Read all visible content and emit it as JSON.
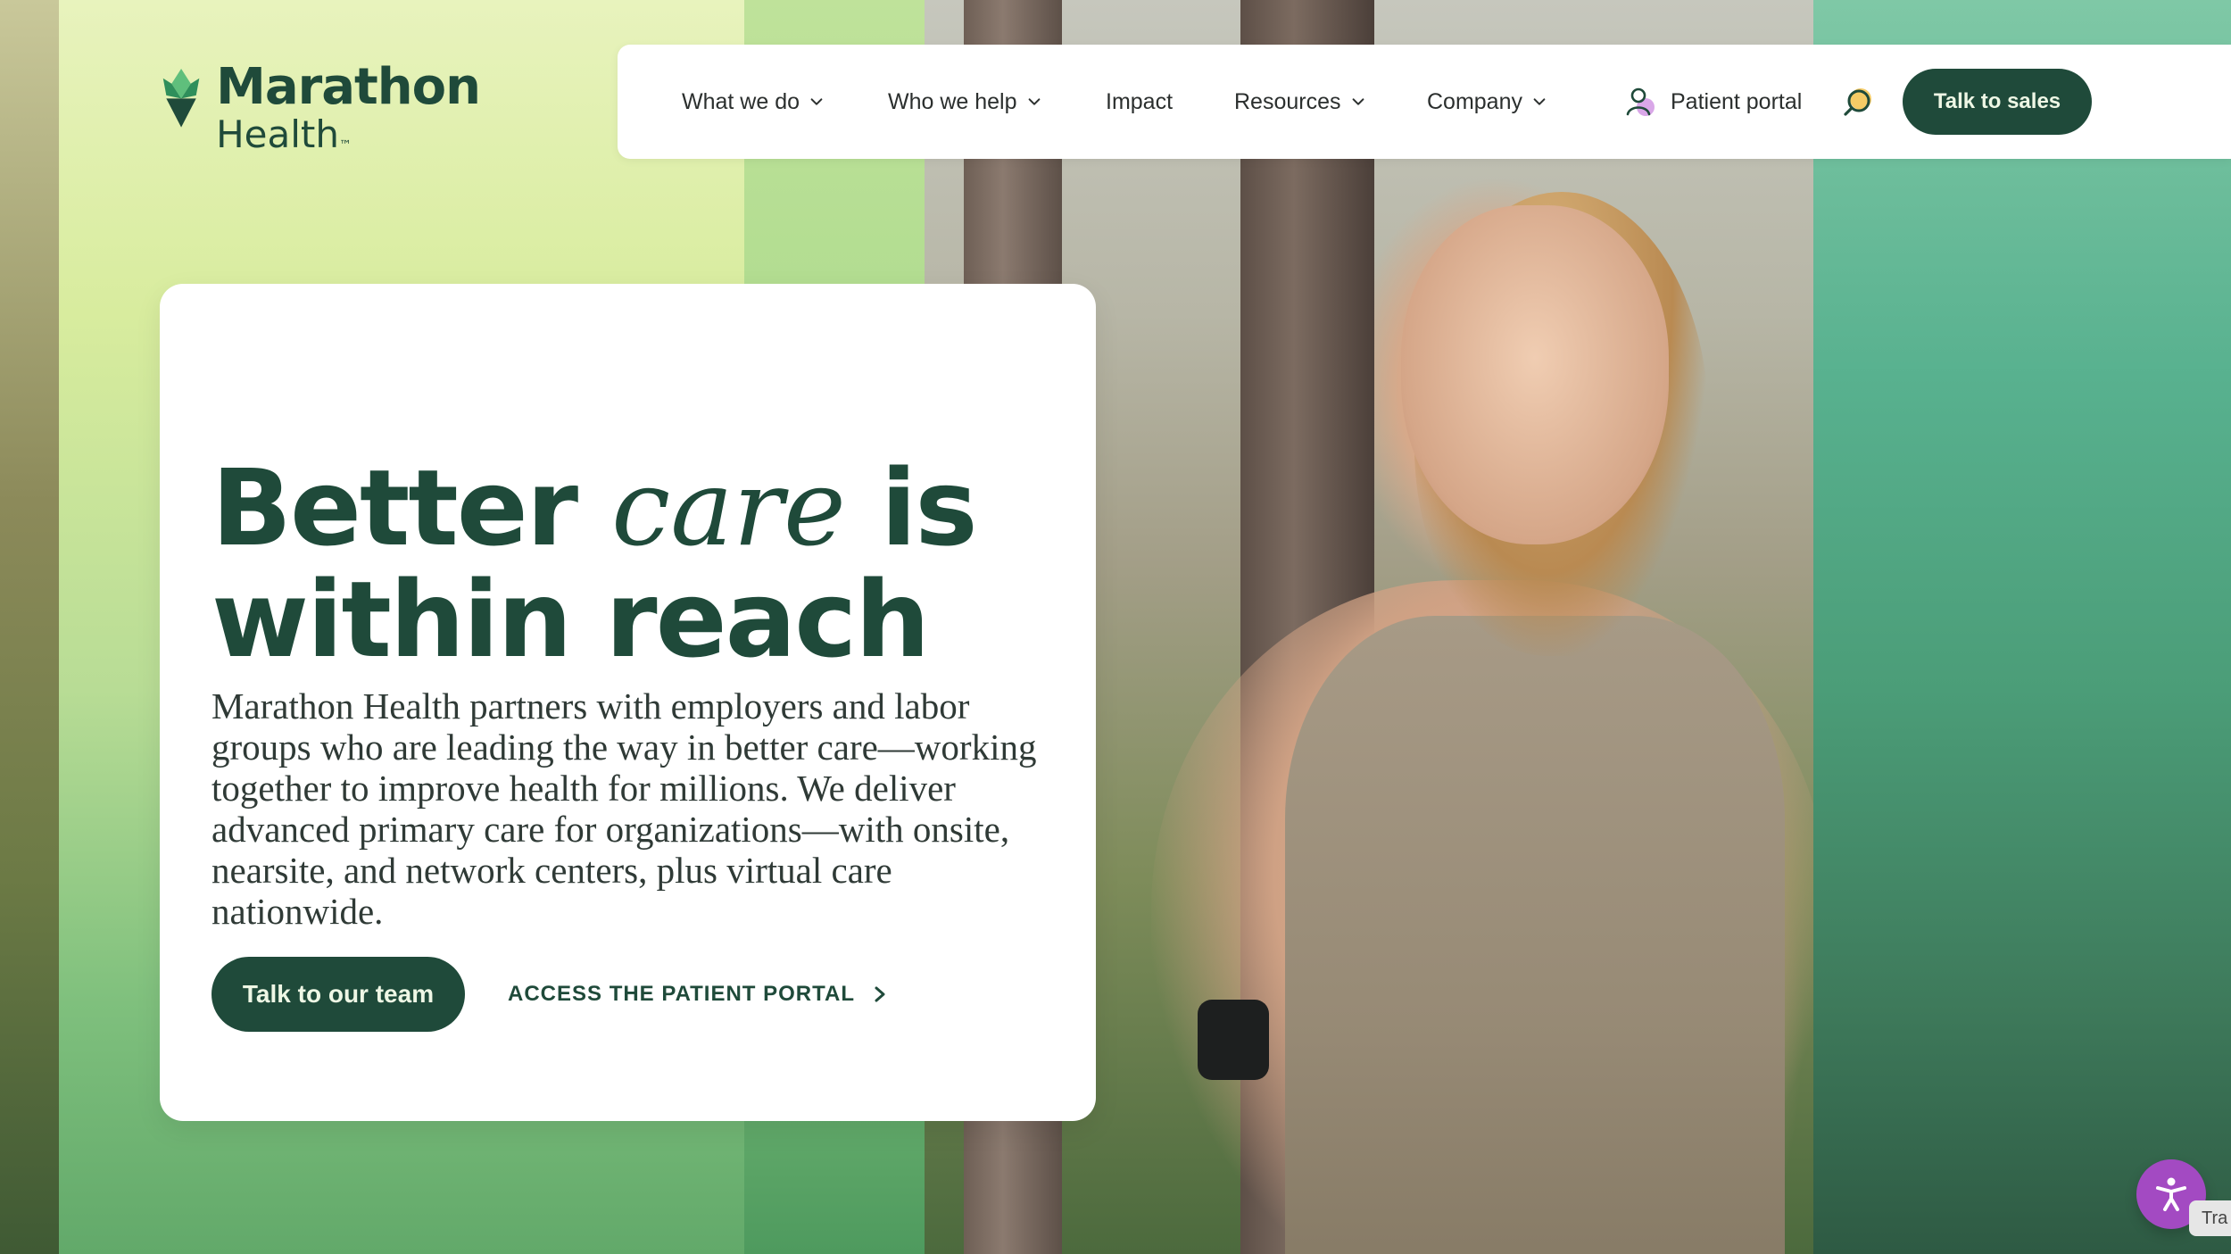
{
  "brand": {
    "name_line1": "Marathon",
    "name_line2": "Health",
    "trademark": "™",
    "colors": {
      "primary_dark_green": "#1f4a3a",
      "button_text": "#eef7e5",
      "accent_purple": "#a34ac2"
    }
  },
  "nav": {
    "items": [
      {
        "label": "What we do",
        "has_dropdown": true
      },
      {
        "label": "Who we help",
        "has_dropdown": true
      },
      {
        "label": "Impact",
        "has_dropdown": false
      },
      {
        "label": "Resources",
        "has_dropdown": true
      },
      {
        "label": "Company",
        "has_dropdown": true
      }
    ],
    "patient_portal": {
      "label": "Patient portal",
      "icon": "user-icon"
    },
    "search": {
      "icon": "search-icon"
    },
    "talk_to_sales": {
      "label": "Talk to sales"
    }
  },
  "hero": {
    "headline": {
      "part1": "Better",
      "part2": "care",
      "part3": "is",
      "line2": "within reach"
    },
    "body": "Marathon Health partners with employers and labor groups who are leading the way in better care—working together to improve health for millions. We deliver advanced primary care for organizations—with onsite, nearsite, and network centers, plus virtual care nationwide.",
    "primary_cta": {
      "label": "Talk to our team"
    },
    "secondary_cta": {
      "label": "ACCESS THE PATIENT PORTAL",
      "icon": "chevron-right-icon"
    }
  },
  "utility": {
    "accessibility_button": {
      "icon": "accessibility-icon"
    },
    "translate_tab": {
      "label": "Tra"
    }
  }
}
